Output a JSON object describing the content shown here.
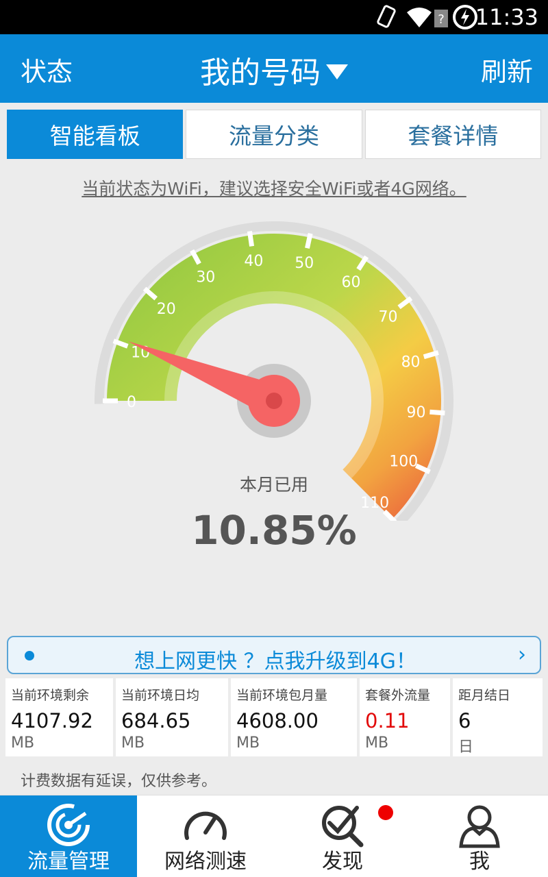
{
  "status_bar": {
    "time": "11:33"
  },
  "header": {
    "left": "状态",
    "title": "我的号码",
    "right": "刷新"
  },
  "tabs": [
    {
      "label": "智能看板",
      "active": true
    },
    {
      "label": "流量分类",
      "active": false
    },
    {
      "label": "套餐详情",
      "active": false
    }
  ],
  "notice": "当前状态为WiFi，建议选择安全WiFi或者4G网络。",
  "gauge": {
    "ticks": [
      "0",
      "10",
      "20",
      "30",
      "40",
      "50",
      "60",
      "70",
      "80",
      "90",
      "100",
      "110"
    ],
    "value": 10.85,
    "label": "本月已用",
    "value_text": "10.85%"
  },
  "banner": {
    "text": "想上网更快 ？点我升级到4G！",
    "chevron": "›"
  },
  "stats": [
    {
      "label": "当前环境剩余",
      "value": "4107.92",
      "unit": "MB"
    },
    {
      "label": "当前环境日均",
      "value": "684.65",
      "unit": "MB"
    },
    {
      "label": "当前环境包月量",
      "value": "4608.00",
      "unit": "MB"
    },
    {
      "label": "套餐外流量",
      "value": "0.11",
      "unit": "MB"
    },
    {
      "label": "距月结日",
      "value": "6",
      "unit": "日"
    }
  ],
  "footnote": "计费数据有延误，仅供参考。",
  "nav": [
    {
      "label": "流量管理",
      "icon": "traffic-icon",
      "active": true
    },
    {
      "label": "网络测速",
      "icon": "speedometer-icon",
      "active": false
    },
    {
      "label": "发现",
      "icon": "discover-icon",
      "active": false,
      "badge": true
    },
    {
      "label": "我",
      "icon": "person-icon",
      "active": false
    }
  ],
  "colors": {
    "accent": "#0b8ad8",
    "needle": "#f56464",
    "warning_red": "#e20a0a"
  }
}
